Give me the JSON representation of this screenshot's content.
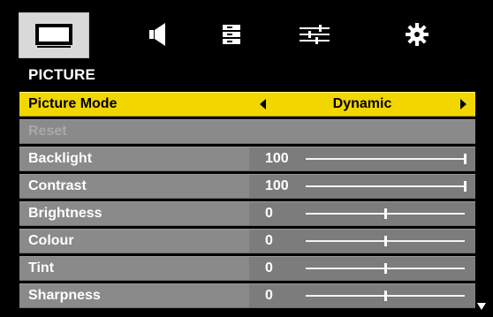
{
  "tabs": [
    {
      "name": "picture-tab",
      "icon": "monitor-icon",
      "active": true
    },
    {
      "name": "sound-tab",
      "icon": "speaker-icon",
      "active": false
    },
    {
      "name": "channel-tab",
      "icon": "list-icon",
      "active": false
    },
    {
      "name": "setup-tab",
      "icon": "sliders-icon",
      "active": false
    },
    {
      "name": "settings-tab",
      "icon": "gear-icon",
      "active": false
    }
  ],
  "section_title": "PICTURE",
  "picture_mode": {
    "label": "Picture Mode",
    "value": "Dynamic"
  },
  "reset": {
    "label": "Reset"
  },
  "settings": [
    {
      "label": "Backlight",
      "value": "100",
      "level": 1.0
    },
    {
      "label": "Contrast",
      "value": "100",
      "level": 1.0
    },
    {
      "label": "Brightness",
      "value": "0",
      "level": 0.5
    },
    {
      "label": "Colour",
      "value": "0",
      "level": 0.5
    },
    {
      "label": "Tint",
      "value": "0",
      "level": 0.5
    },
    {
      "label": "Sharpness",
      "value": "0",
      "level": 0.5
    }
  ],
  "colors": {
    "highlight": "#f2d600",
    "row": "#8a8a8a",
    "background": "#000000"
  }
}
